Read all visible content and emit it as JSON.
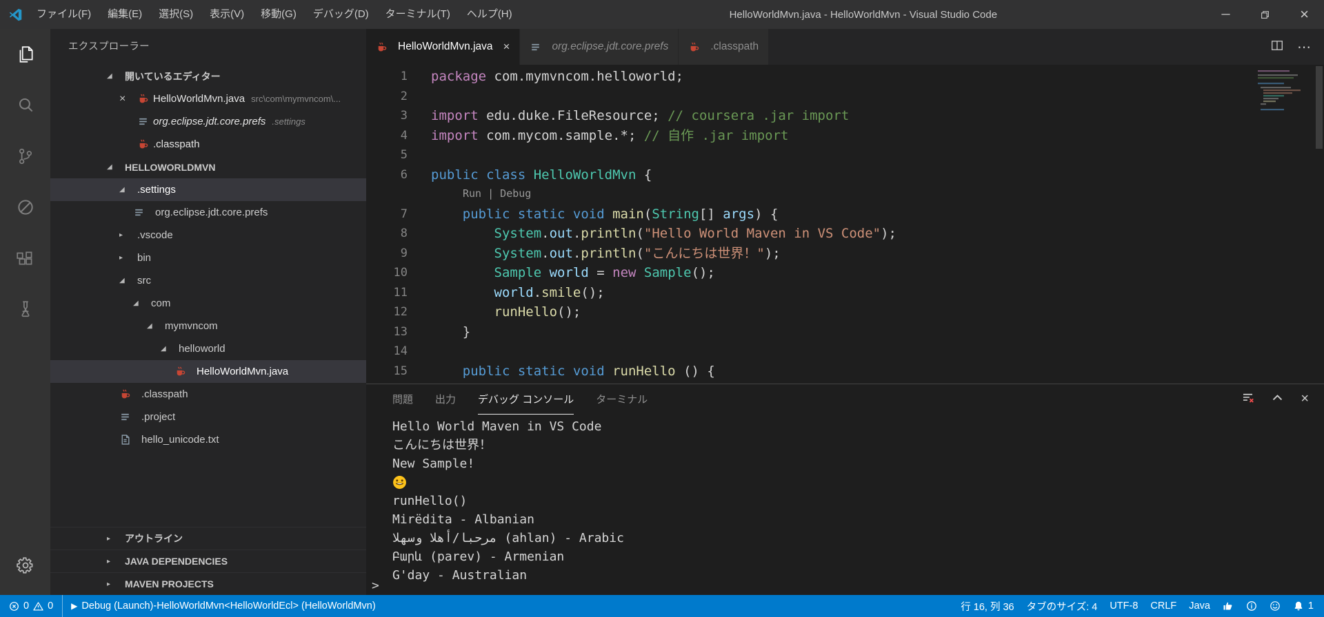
{
  "colors": {
    "statusbar": "#007acc",
    "titlebar": "#323233",
    "activitybar": "#333333",
    "sidebar": "#252526",
    "editor": "#1e1e1e",
    "selection_row": "#37373d",
    "accent_java_icon": "#c74634"
  },
  "icons": {
    "close": "×",
    "chevron_expanded": "◢",
    "chevron_collapsed": "▸",
    "ellipsis": "⋯",
    "minimize": "─",
    "play": "▶",
    "prompt": ">"
  },
  "titlebar": {
    "menus": [
      "ファイル(F)",
      "編集(E)",
      "選択(S)",
      "表示(V)",
      "移動(G)",
      "デバッグ(D)",
      "ターミナル(T)",
      "ヘルプ(H)"
    ],
    "title": "HelloWorldMvn.java - HelloWorldMvn - Visual Studio Code"
  },
  "activity_bar": {
    "items": [
      "explorer",
      "search",
      "source-control",
      "debug",
      "extensions",
      "test"
    ],
    "active": "explorer",
    "bottom": [
      "settings-gear"
    ]
  },
  "sidebar": {
    "title": "エクスプローラー",
    "open_editors_label": "開いているエディター",
    "open_editors": [
      {
        "icon": "java",
        "label": "HelloWorldMvn.java",
        "desc": "src\\com\\mymvncom\\...",
        "close": true
      },
      {
        "icon": "prefs",
        "label": "org.eclipse.jdt.core.prefs",
        "desc": ".settings",
        "preview": true
      },
      {
        "icon": "java",
        "label": ".classpath"
      }
    ],
    "project_label": "HELLOWORLDMVN",
    "tree": [
      {
        "label": ".settings",
        "indent": 1,
        "kind": "folder",
        "expanded": true,
        "selected": true
      },
      {
        "label": "org.eclipse.jdt.core.prefs",
        "indent": 2,
        "kind": "file",
        "icon": "prefs"
      },
      {
        "label": ".vscode",
        "indent": 1,
        "kind": "folder",
        "expanded": false
      },
      {
        "label": "bin",
        "indent": 1,
        "kind": "folder",
        "expanded": false
      },
      {
        "label": "src",
        "indent": 1,
        "kind": "folder",
        "expanded": true
      },
      {
        "label": "com",
        "indent": 2,
        "kind": "folder",
        "expanded": true
      },
      {
        "label": "mymvncom",
        "indent": 3,
        "kind": "folder",
        "expanded": true
      },
      {
        "label": "helloworld",
        "indent": 4,
        "kind": "folder",
        "expanded": true
      },
      {
        "label": "HelloWorldMvn.java",
        "indent": 5,
        "kind": "file",
        "icon": "java",
        "selected": true
      },
      {
        "label": ".classpath",
        "indent": 1,
        "kind": "file",
        "icon": "java"
      },
      {
        "label": ".project",
        "indent": 1,
        "kind": "file",
        "icon": "prefs"
      },
      {
        "label": "hello_unicode.txt",
        "indent": 1,
        "kind": "file",
        "icon": "txt"
      }
    ],
    "bottom_sections": [
      "アウトライン",
      "JAVA DEPENDENCIES",
      "MAVEN PROJECTS"
    ]
  },
  "editor": {
    "tabs": [
      {
        "label": "HelloWorldMvn.java",
        "icon": "java",
        "active": true
      },
      {
        "label": "org.eclipse.jdt.core.prefs",
        "icon": "prefs",
        "preview": true
      },
      {
        "label": ".classpath",
        "icon": "java"
      }
    ],
    "lines": [
      {
        "n": "1",
        "t": [
          [
            "kw",
            "package"
          ],
          [
            "pl",
            " com.mymvncom.helloworld;"
          ]
        ]
      },
      {
        "n": "2",
        "t": []
      },
      {
        "n": "3",
        "t": [
          [
            "kw",
            "import"
          ],
          [
            "pl",
            " edu.duke.FileResource; "
          ],
          [
            "com",
            "// coursera .jar import"
          ]
        ]
      },
      {
        "n": "4",
        "t": [
          [
            "kw",
            "import"
          ],
          [
            "pl",
            " com.mycom.sample.*; "
          ],
          [
            "com",
            "// 自作 .jar import"
          ]
        ]
      },
      {
        "n": "5",
        "t": []
      },
      {
        "n": "6",
        "t": [
          [
            "mod",
            "public class "
          ],
          [
            "type",
            "HelloWorldMvn"
          ],
          [
            "pl",
            " {"
          ]
        ]
      },
      {
        "lens": "Run | Debug"
      },
      {
        "n": "7",
        "t": [
          [
            "pl",
            "    "
          ],
          [
            "mod",
            "public static void "
          ],
          [
            "fn",
            "main"
          ],
          [
            "pl",
            "("
          ],
          [
            "type",
            "String"
          ],
          [
            "pl",
            "[] "
          ],
          [
            "var",
            "args"
          ],
          [
            "pl",
            ") {"
          ]
        ]
      },
      {
        "n": "8",
        "t": [
          [
            "pl",
            "        "
          ],
          [
            "type",
            "System"
          ],
          [
            "pl",
            "."
          ],
          [
            "var",
            "out"
          ],
          [
            "pl",
            "."
          ],
          [
            "fn",
            "println"
          ],
          [
            "pl",
            "("
          ],
          [
            "str",
            "\"Hello World Maven in VS Code\""
          ],
          [
            "pl",
            ");"
          ]
        ]
      },
      {
        "n": "9",
        "t": [
          [
            "pl",
            "        "
          ],
          [
            "type",
            "System"
          ],
          [
            "pl",
            "."
          ],
          [
            "var",
            "out"
          ],
          [
            "pl",
            "."
          ],
          [
            "fn",
            "println"
          ],
          [
            "pl",
            "("
          ],
          [
            "str",
            "\"こんにちは世界！\""
          ],
          [
            "pl",
            ");"
          ]
        ]
      },
      {
        "n": "10",
        "t": [
          [
            "pl",
            "        "
          ],
          [
            "type",
            "Sample"
          ],
          [
            "pl",
            " "
          ],
          [
            "var",
            "world"
          ],
          [
            "pl",
            " = "
          ],
          [
            "kw",
            "new"
          ],
          [
            "pl",
            " "
          ],
          [
            "type",
            "Sample"
          ],
          [
            "pl",
            "();"
          ]
        ]
      },
      {
        "n": "11",
        "t": [
          [
            "pl",
            "        "
          ],
          [
            "var",
            "world"
          ],
          [
            "pl",
            "."
          ],
          [
            "fn",
            "smile"
          ],
          [
            "pl",
            "();"
          ]
        ]
      },
      {
        "n": "12",
        "t": [
          [
            "pl",
            "        "
          ],
          [
            "fn",
            "runHello"
          ],
          [
            "pl",
            "();"
          ]
        ]
      },
      {
        "n": "13",
        "t": [
          [
            "pl",
            "    }"
          ]
        ]
      },
      {
        "n": "14",
        "t": []
      },
      {
        "n": "15",
        "t": [
          [
            "pl",
            "    "
          ],
          [
            "mod",
            "public static void "
          ],
          [
            "fn",
            "runHello"
          ],
          [
            "pl",
            " () {"
          ]
        ]
      }
    ]
  },
  "panel": {
    "tabs": [
      {
        "label": "問題"
      },
      {
        "label": "出力"
      },
      {
        "label": "デバッグ コンソール",
        "active": true
      },
      {
        "label": "ターミナル"
      }
    ],
    "console_lines": [
      {
        "text": "Hello World Maven in VS Code"
      },
      {
        "text": "こんにちは世界！"
      },
      {
        "text": "New Sample!"
      },
      {
        "text": "😄",
        "emoji": true
      },
      {
        "text": "runHello()"
      },
      {
        "text": "Mirëdita - Albanian"
      },
      {
        "text": "مرحبا/أهلا وسهلا (ahlan) - Arabic"
      },
      {
        "text": "Բարև (parev) - Armenian"
      },
      {
        "text": "G'day - Australian"
      }
    ],
    "prompt": ">"
  },
  "statusbar": {
    "errors": "0",
    "warnings": "0",
    "debug_label": "Debug (Launch)-HelloWorldMvn<HelloWorldEcl> (HelloWorldMvn)",
    "line_col": "行 16, 列 36",
    "tab_size": "タブのサイズ: 4",
    "encoding": "UTF-8",
    "eol": "CRLF",
    "language": "Java",
    "notifications": "1"
  }
}
